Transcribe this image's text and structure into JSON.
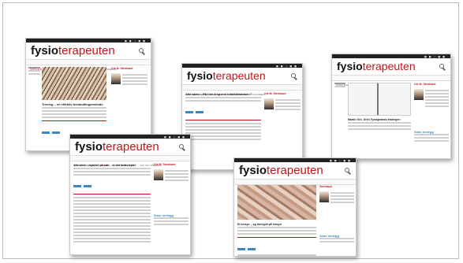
{
  "page": {
    "cards": [
      {
        "logo_bold": "fysio",
        "logo_light": "terapeuten",
        "headline": "Trening – en effektiv behandlingsmetode",
        "sidebar_name": "Ole M. Stenhaud",
        "sidebar_footer": "Siste innlegg"
      },
      {
        "logo_bold": "fysio",
        "logo_light": "terapeuten",
        "headline": "Alle skriv – På tide å spørre klinikkledelsen?",
        "sidebar_name": "Ole M. Stenhaud",
        "sidebar_footer": "Siste innlegg"
      },
      {
        "logo_bold": "fysio",
        "logo_light": "terapeuten",
        "headline": "Martin Gro. Gren Fysiopraksis fastlegen",
        "sidebar_name": "Ole M. Stenhaud",
        "sidebar_footer": "Siste innlegg"
      },
      {
        "logo_bold": "fysio",
        "logo_light": "terapeuten",
        "headline": "Alle skriv – mystisk på vakt – er det bedre byte!",
        "sidebar_name": "Ole M. Stenhaud",
        "sidebar_footer": "Siste innlegg"
      },
      {
        "logo_bold": "fysio",
        "logo_light": "terapeuten",
        "headline": "El innsyn – og formgivt på innsyn",
        "sidebar_name": "Stenhaud",
        "sidebar_footer": "Siste innlegg"
      }
    ],
    "nav_items": [
      "SISTE ENDRINGER",
      "BLOGG",
      "FAG OG FORSKNING",
      "FAG OG YRKESLIV",
      "FAGINDEKS",
      "FORUM",
      "DEBATT"
    ]
  }
}
